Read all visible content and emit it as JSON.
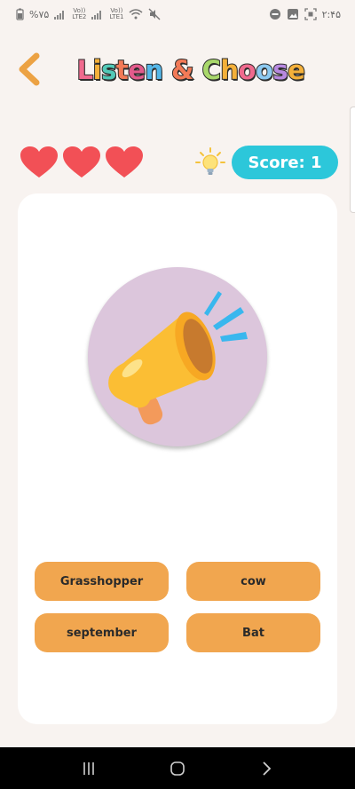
{
  "status_bar": {
    "battery": "%۷۵",
    "signal1": "Vo))\nLTE2",
    "signal2": "Vo))\nLTE1",
    "time": "۲:۴۵"
  },
  "header": {
    "title_letters": [
      "L",
      "i",
      "s",
      "t",
      "e",
      "n",
      " ",
      "&",
      " ",
      "C",
      "h",
      "o",
      "o",
      "s",
      "e"
    ],
    "title_colors": [
      "#f06a8e",
      "#f4b03a",
      "#52c9b7",
      "#f27a57",
      "#e35b8c",
      "#55b7e8",
      " ",
      "#f27a57",
      " ",
      "#a9d86b",
      "#f4b03a",
      "#f06a8e",
      "#8cc9f0",
      "#b889e0",
      "#f4b03a"
    ]
  },
  "lives": {
    "count": 3,
    "color": "#f25056"
  },
  "score": {
    "label": "Score: 1"
  },
  "choices": [
    {
      "label": "Grasshopper"
    },
    {
      "label": "cow"
    },
    {
      "label": "september"
    },
    {
      "label": "Bat"
    }
  ],
  "colors": {
    "accent_orange": "#f1a64f",
    "score_blue": "#2cc7da",
    "speaker_bg": "#dcc6dc"
  }
}
